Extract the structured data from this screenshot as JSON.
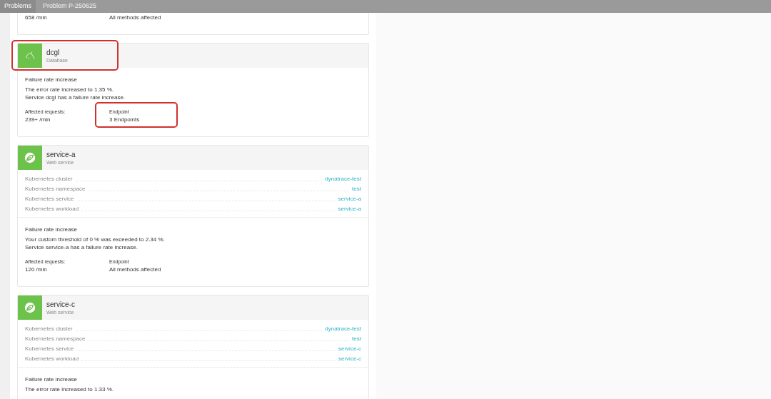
{
  "breadcrumbs": [
    {
      "label": "Problems"
    },
    {
      "label": "Problem P-250625"
    }
  ],
  "cards": [
    {
      "problem": {
        "metrics": [
          {
            "value": "658 /min"
          },
          {
            "value": "All methods affected"
          }
        ]
      }
    },
    {
      "header": {
        "name": "dcgl",
        "type": "Database",
        "kind": "database",
        "highlighted": true
      },
      "problem": {
        "title": "Failure rate increase",
        "lines": [
          "The error rate increased to 1.35 %.",
          "Service dcgl has a failure rate increase."
        ],
        "metrics": [
          {
            "label": "Affected requests:",
            "value": "239+ /min"
          },
          {
            "label": "Endpoint",
            "value": "3 Endpoints",
            "highlighted": true
          }
        ]
      }
    },
    {
      "header": {
        "name": "service-a",
        "type": "Web service",
        "kind": "web"
      },
      "properties": [
        {
          "label": "Kubernetes cluster",
          "value": "dynatrace-test"
        },
        {
          "label": "Kubernetes namespace",
          "value": "test"
        },
        {
          "label": "Kubernetes service",
          "value": "service-a"
        },
        {
          "label": "Kubernetes workload",
          "value": "service-a"
        }
      ],
      "problem": {
        "title": "Failure rate increase",
        "lines": [
          "Your custom threshold of 0 % was exceeded to 2.34 %.",
          "Service service-a has a failure rate increase."
        ],
        "metrics": [
          {
            "label": "Affected requests:",
            "value": "120 /min"
          },
          {
            "label": "Endpoint",
            "value": "All methods affected"
          }
        ]
      }
    },
    {
      "header": {
        "name": "service-c",
        "type": "Web service",
        "kind": "web"
      },
      "properties": [
        {
          "label": "Kubernetes cluster",
          "value": "dynatrace-test"
        },
        {
          "label": "Kubernetes namespace",
          "value": "test"
        },
        {
          "label": "Kubernetes service",
          "value": "service-c"
        },
        {
          "label": "Kubernetes workload",
          "value": "service-c"
        }
      ],
      "problem": {
        "title": "Failure rate increase",
        "lines": [
          "The error rate increased to 1.33 %."
        ]
      }
    }
  ]
}
